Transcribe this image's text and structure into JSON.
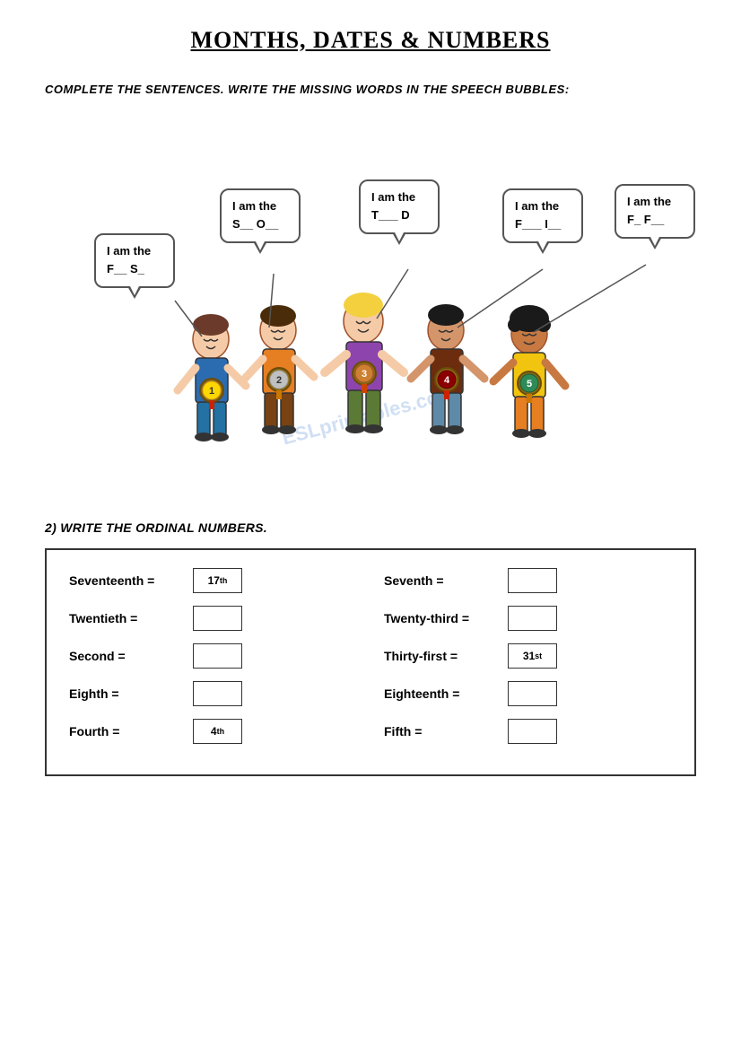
{
  "page": {
    "title": "MONTHS, DATES & NUMBERS",
    "instruction": "COMPLETE THE SENTENCES. WRITE THE MISSING WORDS IN THE SPEECH BUBBLES:",
    "section2_title": "2) WRITE THE ORDINAL NUMBERS.",
    "watermark": "ESLprintables.com"
  },
  "bubbles": [
    {
      "id": "bubble1",
      "line1": "I am the",
      "line2": "F__ S_"
    },
    {
      "id": "bubble2",
      "line1": "I am the",
      "line2": "S__ O__"
    },
    {
      "id": "bubble3",
      "line1": "I am the",
      "line2": "T___ D"
    },
    {
      "id": "bubble4",
      "line1": "I am the",
      "line2": "F___ I__"
    },
    {
      "id": "bubble5",
      "line1": "I am the",
      "line2": "F_ F__"
    }
  ],
  "numbers_left": [
    {
      "label": "Seventeenth =",
      "answer": "17th",
      "has_answer": true,
      "sup": "th"
    },
    {
      "label": "Twentieth =",
      "answer": "",
      "has_answer": false,
      "sup": ""
    },
    {
      "label": "Second =",
      "answer": "",
      "has_answer": false,
      "sup": ""
    },
    {
      "label": "Eighth =",
      "answer": "",
      "has_answer": false,
      "sup": ""
    },
    {
      "label": "Fourth =",
      "answer": "4th",
      "has_answer": true,
      "sup": "th"
    }
  ],
  "numbers_right": [
    {
      "label": "Seventh =",
      "answer": "",
      "has_answer": false,
      "sup": ""
    },
    {
      "label": "Twenty-third =",
      "answer": "",
      "has_answer": false,
      "sup": ""
    },
    {
      "label": "Thirty-first =",
      "answer": "31st",
      "has_answer": true,
      "sup": "st"
    },
    {
      "label": "Eighteenth =",
      "answer": "",
      "has_answer": false,
      "sup": ""
    },
    {
      "label": "Fifth =",
      "answer": "",
      "has_answer": false,
      "sup": ""
    }
  ],
  "children": [
    {
      "id": 1,
      "medal_num": "1",
      "medal_class": "gold",
      "shirt_color": "#2B6CB0",
      "pants_color": "#2471A3",
      "hair_color": "#6B3A2A"
    },
    {
      "id": 2,
      "medal_num": "2",
      "medal_class": "silver",
      "shirt_color": "#E67E22",
      "pants_color": "#784212",
      "hair_color": "#4a2c0a"
    },
    {
      "id": 3,
      "medal_num": "3",
      "medal_class": "bronze",
      "shirt_color": "#8E44AD",
      "pants_color": "#5B7A35",
      "hair_color": "#F4D03F"
    },
    {
      "id": 4,
      "medal_num": "4",
      "medal_class": "med4",
      "shirt_color": "#6B2D0E",
      "pants_color": "#5D8AA8",
      "hair_color": "#1a1a1a"
    },
    {
      "id": 5,
      "medal_num": "5",
      "medal_class": "med5",
      "shirt_color": "#F1C40F",
      "pants_color": "#E67E22",
      "hair_color": "#1a1a1a"
    }
  ]
}
